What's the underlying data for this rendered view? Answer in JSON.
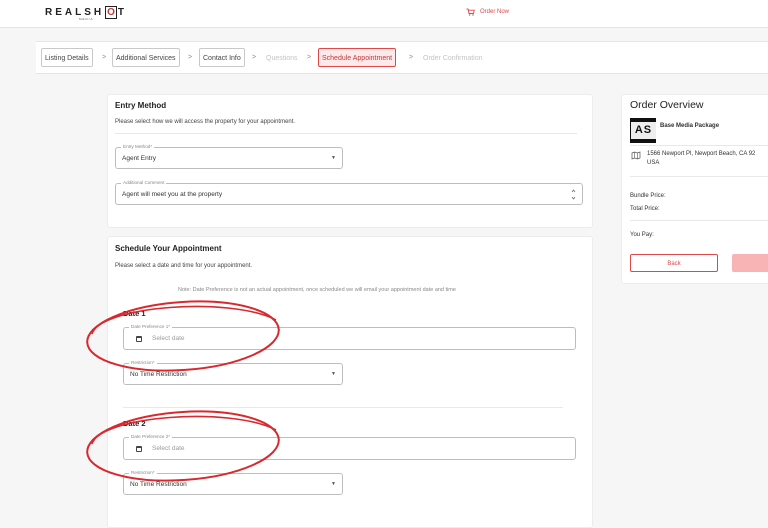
{
  "header": {
    "logo": {
      "text_before": "REALSH",
      "text_boxed": "O",
      "text_after": "T",
      "subtext": "MEDIA"
    },
    "order_now": "Order Now",
    "cart_icon": "cart-icon"
  },
  "steps": [
    {
      "label": "Listing Details",
      "state": "done"
    },
    {
      "label": "Additional Services",
      "state": "done"
    },
    {
      "label": "Contact Info",
      "state": "done"
    },
    {
      "label": "Questions",
      "state": "pending"
    },
    {
      "label": "Schedule Appointment",
      "state": "active"
    },
    {
      "label": "Order Confirmation",
      "state": "pending"
    }
  ],
  "step_separator": ">",
  "entry": {
    "title": "Entry Method",
    "description": "Please select how we will access the property for your appointment.",
    "entry_method": {
      "label": "Entry Method*",
      "value": "Agent Entry"
    },
    "comment": {
      "label": "Additional Comment",
      "value": "Agent will meet you at the property"
    }
  },
  "schedule": {
    "title": "Schedule Your Appointment",
    "description": "Please select a date and time for your appointment.",
    "note": "Note: Date Preference is not an actual appointment, once scheduled we will email your appointment date and time",
    "dates": [
      {
        "title": "Date 1",
        "pref_label": "Date Preference 1*",
        "placeholder": "Select date",
        "restriction_label": "Restriction*",
        "restriction_value": "No Time Restriction"
      },
      {
        "title": "Date 2",
        "pref_label": "Date Preference 2*",
        "placeholder": "Select date",
        "restriction_label": "Restriction*",
        "restriction_value": "No Time Restriction"
      }
    ]
  },
  "overview": {
    "title": "Order Overview",
    "thumb_text": "AS",
    "package": "Base Media Package",
    "address_line1": "1566 Newport Pl, Newport Beach, CA 92",
    "address_line2": "USA",
    "bundle_price_label": "Bundle Price:",
    "total_price_label": "Total Price:",
    "you_pay_label": "You Pay:",
    "back": "Back"
  },
  "colors": {
    "accent": "#e04848",
    "annotation": "#d9282e",
    "active_step_bg": "#fde9e9"
  },
  "icons": [
    "cart-icon",
    "chevron-right-icon",
    "caret-down-icon",
    "resize-icon",
    "calendar-icon",
    "map-icon"
  ]
}
